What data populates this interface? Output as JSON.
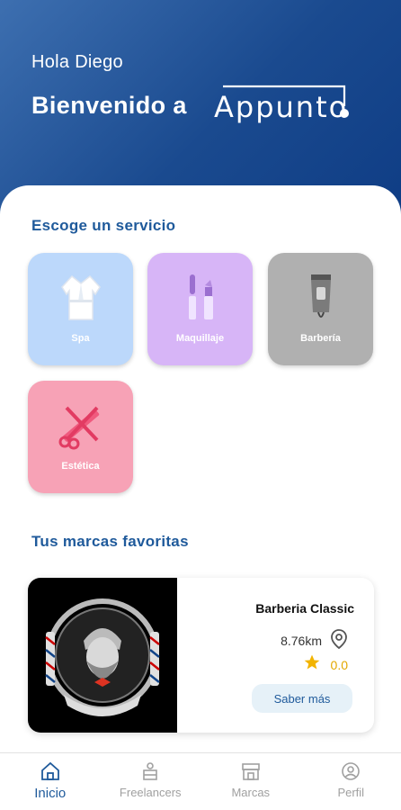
{
  "header": {
    "greeting": "Hola Diego",
    "welcome": "Bienvenido a",
    "logo_text": "Appunto"
  },
  "services": {
    "title": "Escoge un servicio",
    "items": [
      {
        "label": "Spa",
        "icon": "robe-icon",
        "color": "#bcd8fb"
      },
      {
        "label": "Maquillaje",
        "icon": "makeup-icon",
        "color": "#d7b5f7"
      },
      {
        "label": "Barbería",
        "icon": "clipper-icon",
        "color": "#b0b0b0"
      },
      {
        "label": "Estética",
        "icon": "scissors-comb-icon",
        "color": "#f7a2b6"
      }
    ]
  },
  "favorites": {
    "title": "Tus marcas favoritas",
    "card": {
      "name": "Barberia Classic",
      "distance": "8.76km",
      "rating": "0.0",
      "button": "Saber más"
    }
  },
  "nav": [
    {
      "label": "Inicio",
      "icon": "home-icon",
      "active": true
    },
    {
      "label": "Freelancers",
      "icon": "freelancer-icon",
      "active": false
    },
    {
      "label": "Marcas",
      "icon": "store-icon",
      "active": false
    },
    {
      "label": "Perfil",
      "icon": "profile-icon",
      "active": false
    }
  ],
  "colors": {
    "primary": "#1f5a9b",
    "star": "#f2b400"
  }
}
